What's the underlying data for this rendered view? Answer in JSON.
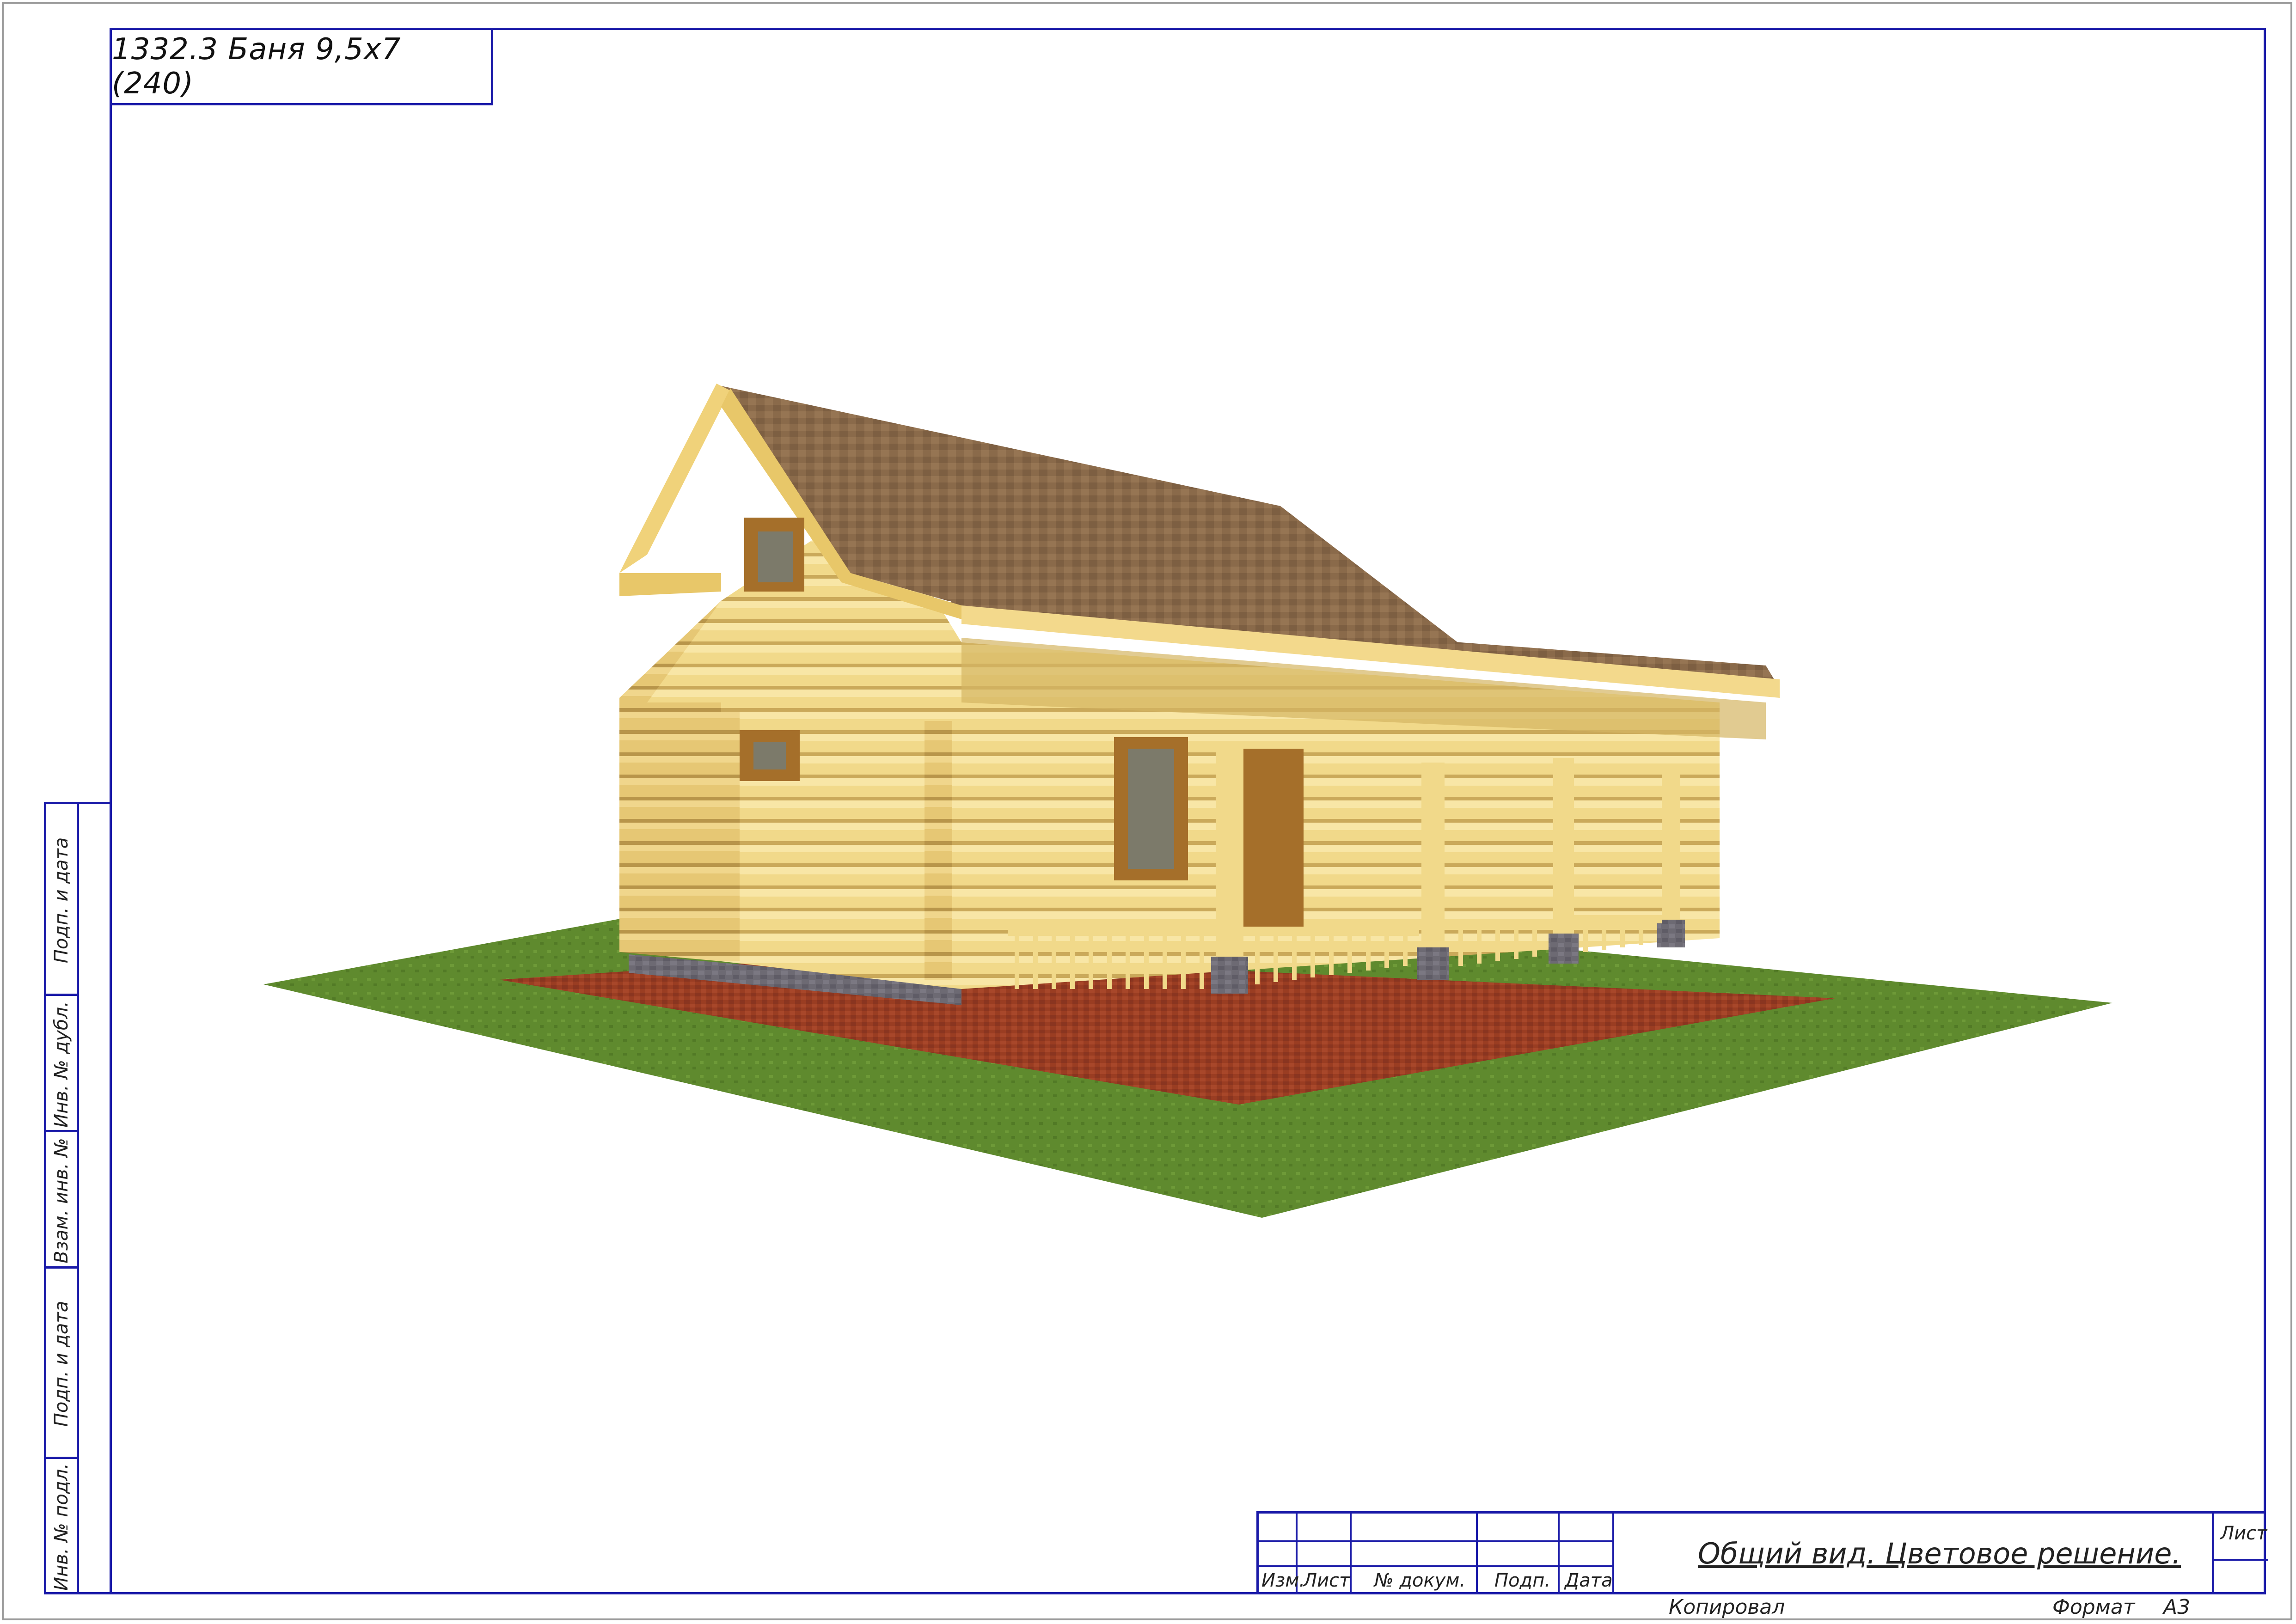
{
  "sheet": {
    "title": "1332.3 Баня 9,5х7 (240)",
    "side_labels": [
      "Подп. и дата",
      "Инв. № дубл.",
      "Взам. инв. №",
      "Подп. и дата",
      "Инв. № подл."
    ],
    "title_block": {
      "columns": [
        "Изм.",
        "Лист",
        "№ докум.",
        "Подп.",
        "Дата"
      ],
      "drawing_title": "Общий вид. Цветовое решение.",
      "sheet_label": "Лист"
    },
    "footer": {
      "copied": "Копировал",
      "format_label": "Формат",
      "format_value": "А3"
    }
  },
  "colors": {
    "frame": "#1a1aa8",
    "roof": "#8a6a4a",
    "logs": "#f1d98a",
    "grass": "#5f8a2e",
    "paving": "#9a3d22"
  },
  "illustration": {
    "subject": "log-bathhouse-render"
  }
}
